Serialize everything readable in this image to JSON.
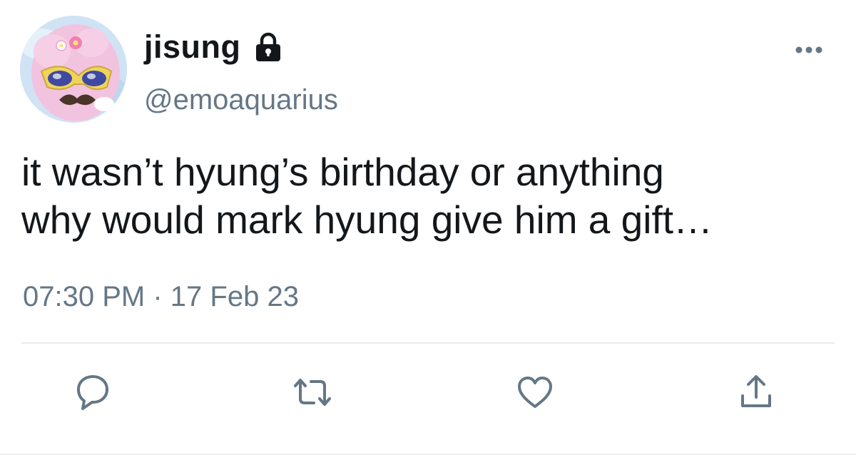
{
  "user": {
    "display_name": "jisung",
    "handle": "@emoaquarius",
    "protected_icon": "lock-icon",
    "avatar_icon": "avatar-image"
  },
  "tweet": {
    "lines": [
      "it wasn’t hyung’s birthday or anything",
      "why would mark hyung give him a gift…"
    ],
    "time": "07:30 PM",
    "separator": "·",
    "date": "17 Feb 23"
  },
  "actions": {
    "reply_icon": "reply-icon",
    "retweet_icon": "retweet-icon",
    "like_icon": "heart-icon",
    "share_icon": "share-icon",
    "more_icon": "more-icon"
  },
  "colors": {
    "text_primary": "#14171a",
    "text_secondary": "#657786",
    "icon": "#657786",
    "divider": "#e6ecf0"
  }
}
